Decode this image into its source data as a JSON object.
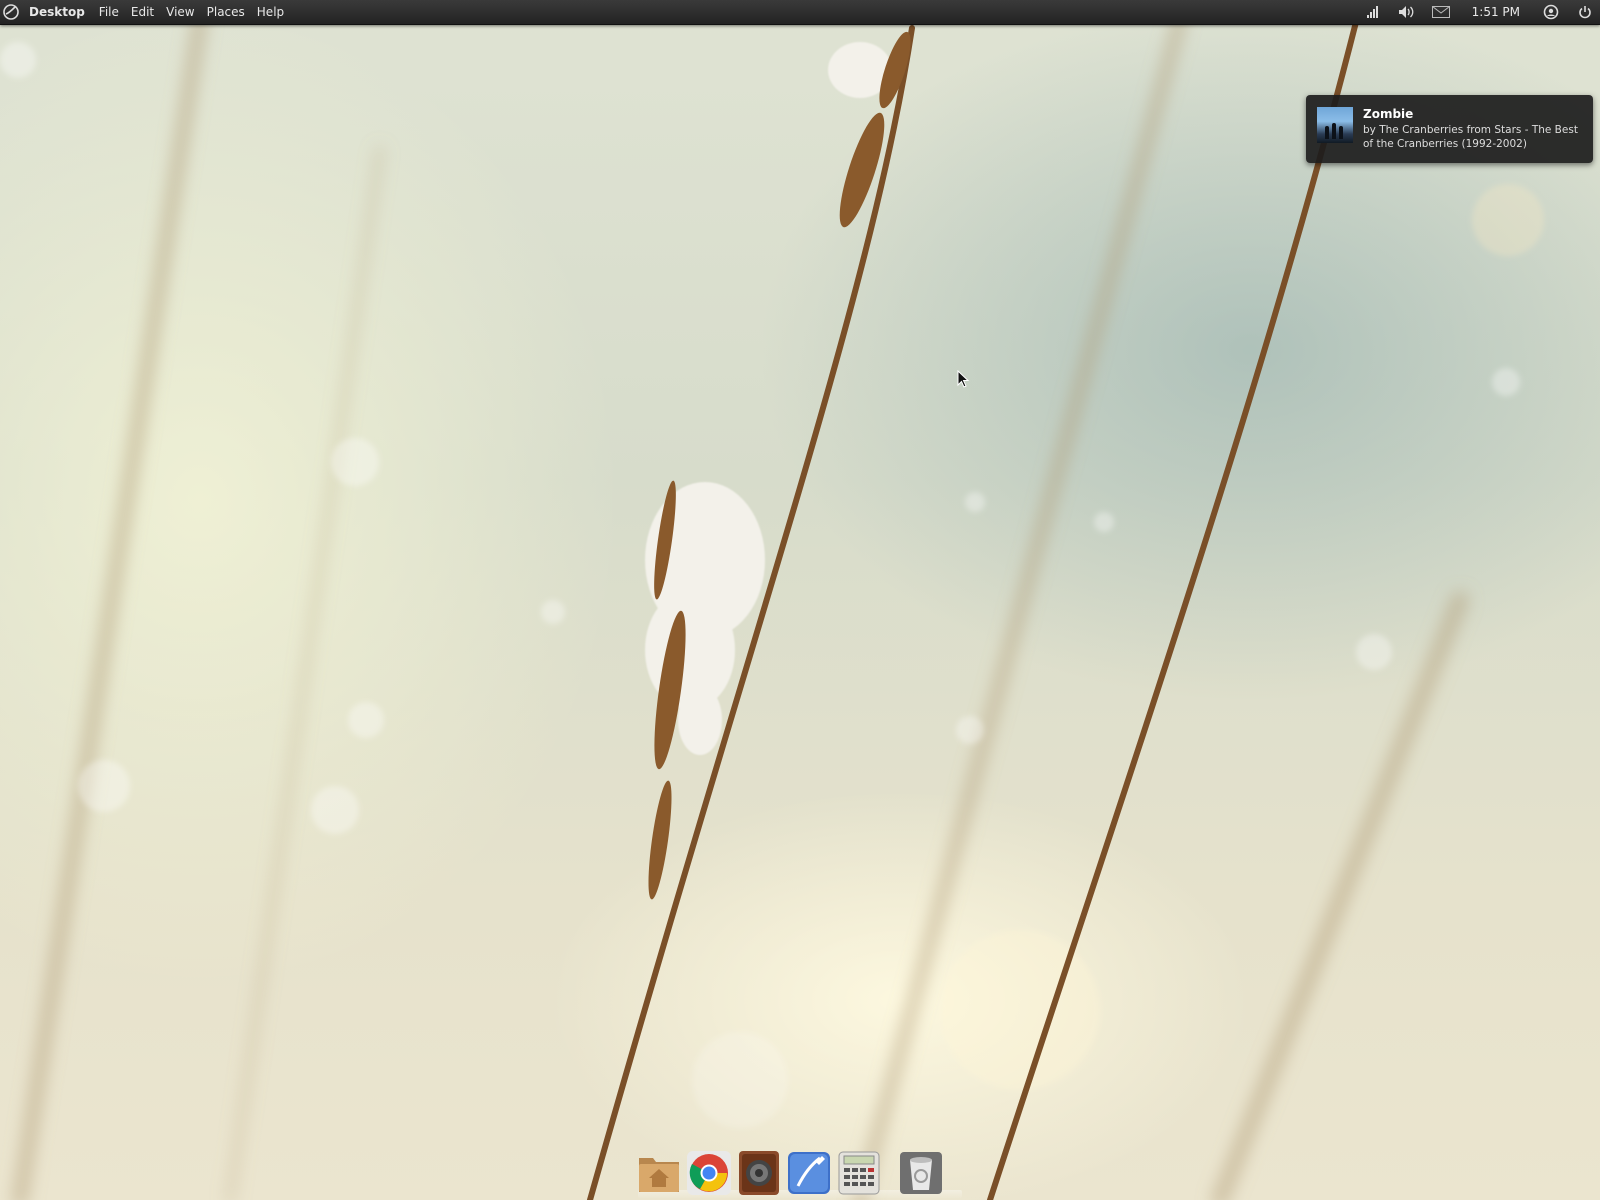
{
  "top_panel": {
    "app_name": "Desktop",
    "menus": [
      "File",
      "Edit",
      "View",
      "Places",
      "Help"
    ],
    "clock": "1:51 PM",
    "tray_icons": [
      "network-signal-icon",
      "volume-icon",
      "mail-icon",
      "user-icon",
      "power-icon"
    ]
  },
  "notification": {
    "title": "Zombie",
    "body": "by The Cranberries from Stars - The Best of the Cranberries (1992-2002)"
  },
  "dock": {
    "items": [
      "home-folder-icon",
      "chrome-icon",
      "music-player-icon",
      "text-editor-icon",
      "calculator-icon",
      "trash-icon"
    ]
  },
  "colors": {
    "panel": "#2b2b2b",
    "notification_bg": "#1c1c1c"
  }
}
